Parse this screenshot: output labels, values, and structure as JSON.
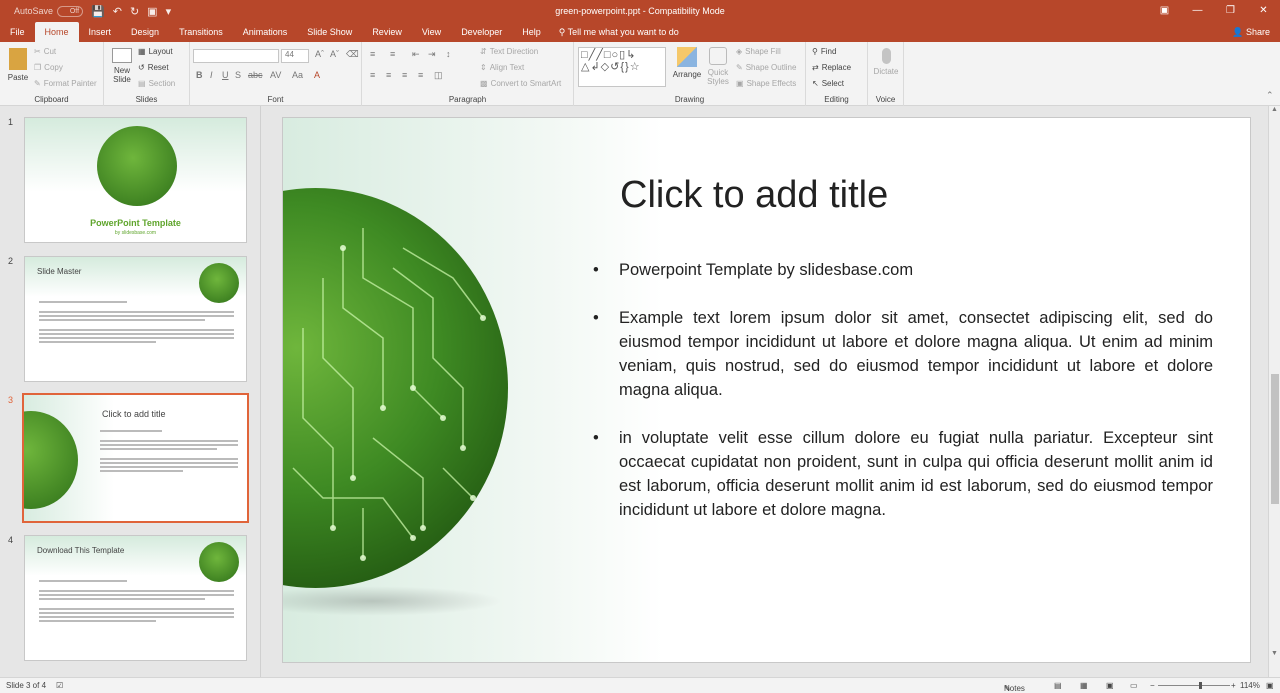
{
  "window": {
    "autosave_label": "AutoSave",
    "autosave_state": "Off",
    "doc_title": "green-powerpoint.ppt - Compatibility Mode",
    "share_label": "Share",
    "accent_color": "#b7472a",
    "selection_color": "#e0643a"
  },
  "tabs": [
    "File",
    "Home",
    "Insert",
    "Design",
    "Transitions",
    "Animations",
    "Slide Show",
    "Review",
    "View",
    "Developer",
    "Help"
  ],
  "active_tab": "Home",
  "tell_me": "Tell me what you want to do",
  "ribbon": {
    "clipboard": {
      "label": "Clipboard",
      "paste": "Paste",
      "cut": "Cut",
      "copy": "Copy",
      "format_painter": "Format Painter"
    },
    "slides": {
      "label": "Slides",
      "new_slide": "New Slide",
      "layout": "Layout",
      "reset": "Reset",
      "section": "Section"
    },
    "font": {
      "label": "Font",
      "size": "44"
    },
    "paragraph": {
      "label": "Paragraph",
      "text_direction": "Text Direction",
      "align_text": "Align Text",
      "convert_smartart": "Convert to SmartArt"
    },
    "drawing": {
      "label": "Drawing",
      "arrange": "Arrange",
      "quick_styles": "Quick Styles",
      "shape_fill": "Shape Fill",
      "shape_outline": "Shape Outline",
      "shape_effects": "Shape Effects"
    },
    "editing": {
      "label": "Editing",
      "find": "Find",
      "replace": "Replace",
      "select": "Select"
    },
    "voice": {
      "label": "Voice",
      "dictate": "Dictate"
    }
  },
  "thumbnails": [
    {
      "num": "1",
      "title": "PowerPoint Template",
      "subtitle": "by slidesbase.com"
    },
    {
      "num": "2",
      "title": "Slide Master"
    },
    {
      "num": "3",
      "title": "Click to add title"
    },
    {
      "num": "4",
      "title": "Download This Template"
    }
  ],
  "slide": {
    "title": "Click to add title",
    "bullets": [
      "Powerpoint Template by slidesbase.com",
      "Example text lorem ipsum dolor sit amet, consectet adipiscing elit, sed do eiusmod tempor incididunt ut labore et dolore magna aliqua. Ut enim ad minim veniam, quis nostrud, sed do eiusmod tempor incididunt ut labore et dolore magna aliqua.",
      "in voluptate velit esse cillum dolore eu fugiat nulla pariatur. Excepteur sint occaecat cupidatat non proident, sunt in culpa qui officia deserunt mollit anim id est laborum, officia deserunt mollit anim id est laborum, sed do eiusmod tempor incididunt ut labore et dolore magna."
    ]
  },
  "status": {
    "slide_of": "Slide 3 of 4",
    "notes": "Notes",
    "zoom": "114%",
    "zoom_level": 0.57
  }
}
